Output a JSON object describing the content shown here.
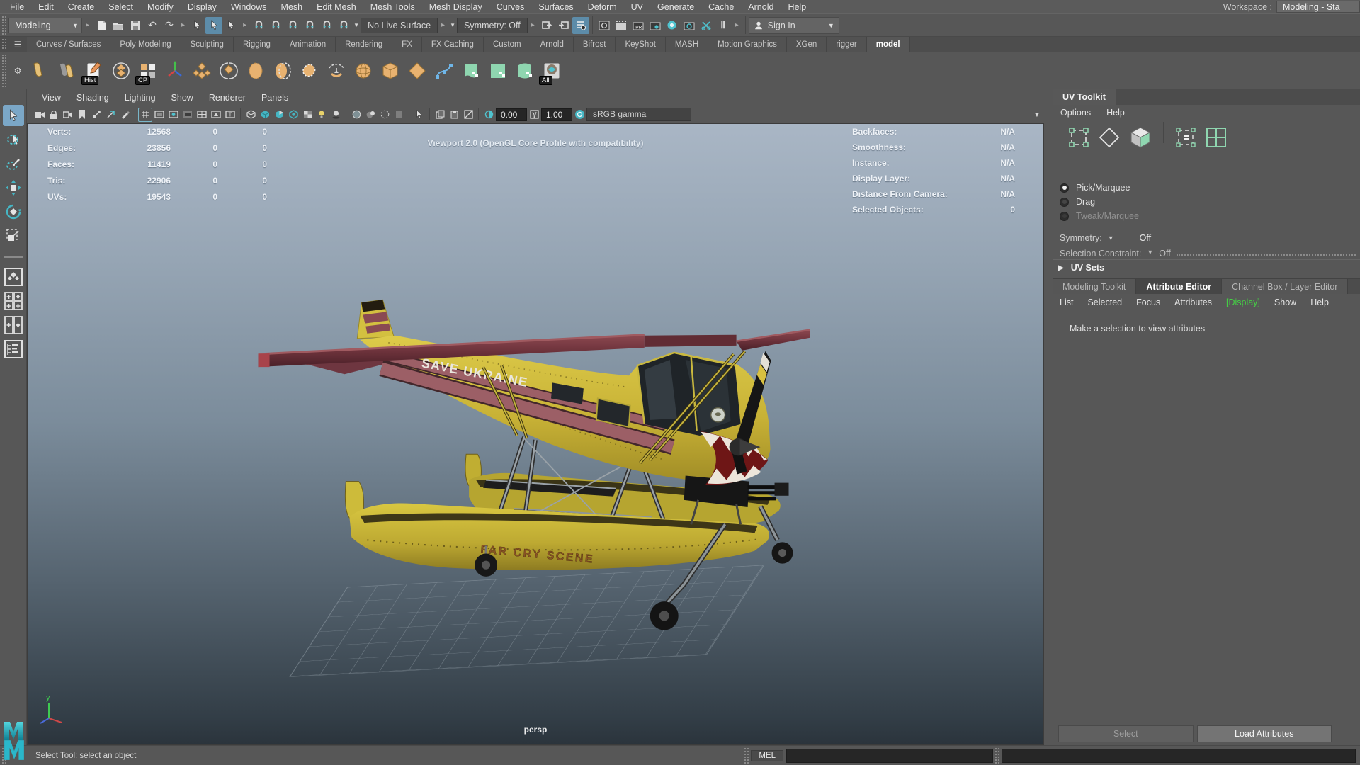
{
  "titlebar": {
    "workspace_label": "Workspace :",
    "workspace_value": "Modeling - Sta"
  },
  "menubar": {
    "items": [
      "File",
      "Edit",
      "Create",
      "Select",
      "Modify",
      "Display",
      "Windows",
      "Mesh",
      "Edit Mesh",
      "Mesh Tools",
      "Mesh Display",
      "Curves",
      "Surfaces",
      "Deform",
      "UV",
      "Generate",
      "Cache",
      "Arnold",
      "Help"
    ]
  },
  "toolbar": {
    "menuset_value": "Modeling",
    "live_surface_value": "No Live Surface",
    "symmetry_value": "Symmetry: Off",
    "signin_label": "Sign In"
  },
  "shelf": {
    "tabs": [
      "Curves / Surfaces",
      "Poly Modeling",
      "Sculpting",
      "Rigging",
      "Animation",
      "Rendering",
      "FX",
      "FX Caching",
      "Custom",
      "Arnold",
      "Bifrost",
      "KeyShot",
      "MASH",
      "Motion Graphics",
      "XGen",
      "rigger",
      "model"
    ],
    "active_tab": "model",
    "badge_hist": "Hist",
    "badge_cp": "CP",
    "badge_all": "All"
  },
  "viewport": {
    "menus": [
      "View",
      "Shading",
      "Lighting",
      "Show",
      "Renderer",
      "Panels"
    ],
    "exposure_value": "0.00",
    "gamma_value": "1.00",
    "colorspace_value": "sRGB gamma",
    "renderer_label": "Viewport 2.0 (OpenGL Core Profile with compatibility)",
    "camera_label": "persp",
    "axis_y_label": "y",
    "hud_left": [
      {
        "label": "Verts:",
        "v1": "12568",
        "v2": "0",
        "v3": "0"
      },
      {
        "label": "Edges:",
        "v1": "23856",
        "v2": "0",
        "v3": "0"
      },
      {
        "label": "Faces:",
        "v1": "11419",
        "v2": "0",
        "v3": "0"
      },
      {
        "label": "Tris:",
        "v1": "22906",
        "v2": "0",
        "v3": "0"
      },
      {
        "label": "UVs:",
        "v1": "19543",
        "v2": "0",
        "v3": "0"
      }
    ],
    "hud_right": [
      {
        "label": "Backfaces:",
        "value": "N/A"
      },
      {
        "label": "Smoothness:",
        "value": "N/A"
      },
      {
        "label": "Instance:",
        "value": "N/A"
      },
      {
        "label": "Display Layer:",
        "value": "N/A"
      },
      {
        "label": "Distance From Camera:",
        "value": "N/A"
      },
      {
        "label": "Selected Objects:",
        "value": "0"
      }
    ],
    "model_decals": {
      "side_text": "SAVE UKRAINE",
      "float_text": "FAR CRY SCENE"
    }
  },
  "uv_toolkit": {
    "tab_title": "UV Toolkit",
    "menu_options": "Options",
    "menu_help": "Help",
    "radio_pick": "Pick/Marquee",
    "radio_drag": "Drag",
    "radio_tweak": "Tweak/Marquee",
    "symmetry_label": "Symmetry:",
    "symmetry_value": "Off",
    "constraint_label": "Selection Constraint:",
    "constraint_value": "Off",
    "uv_sets_label": "UV Sets"
  },
  "editor_panel": {
    "tabs": [
      "Modeling Toolkit",
      "Attribute Editor",
      "Channel Box / Layer Editor"
    ],
    "active_tab": "Attribute Editor",
    "menu": [
      "List",
      "Selected",
      "Focus",
      "Attributes",
      "[Display]",
      "Show",
      "Help"
    ],
    "empty_message": "Make a selection to view attributes",
    "select_button": "Select",
    "load_button": "Load Attributes"
  },
  "statusbar": {
    "help_text": "Select Tool: select an object",
    "mel_label": "MEL"
  },
  "colors": {
    "accent_teal": "#4fc3cf",
    "highlight_blue": "#7ba7c7",
    "display_green": "#45d145",
    "mint": "#8fd6b0",
    "fuselage_yellow": "#d8c63e",
    "wing_maroon": "#7d3d46"
  }
}
